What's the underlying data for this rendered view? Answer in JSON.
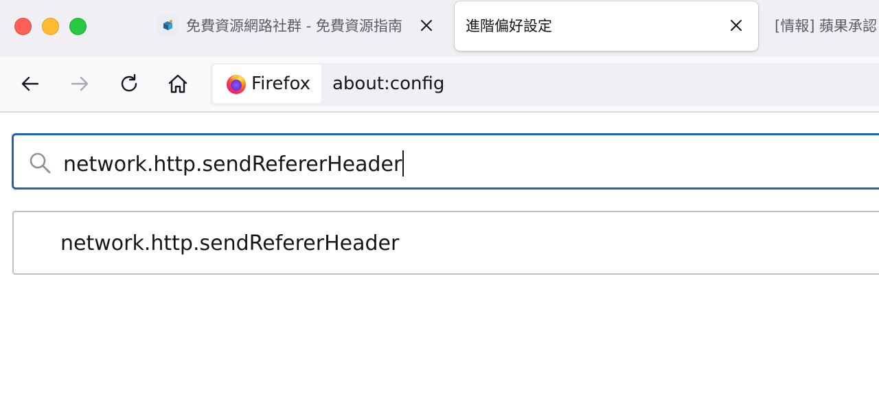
{
  "window": {
    "controls": [
      "close",
      "minimize",
      "maximize"
    ]
  },
  "tabs": [
    {
      "title": "免費資源網路社群 - 免費資源指南",
      "favicon": "site-logo-icon",
      "active": false,
      "has_close": true
    },
    {
      "title": "進階偏好設定",
      "favicon": null,
      "active": true,
      "has_close": true
    },
    {
      "title": "[情報] 蘋果承認",
      "favicon": null,
      "active": false,
      "has_close": false
    }
  ],
  "toolbar": {
    "buttons": [
      "back-icon",
      "forward-icon",
      "reload-icon",
      "home-icon"
    ],
    "forward_enabled": false
  },
  "urlbar": {
    "identity_label": "Firefox",
    "identity_icon": "firefox-logo-icon",
    "url": "about:config"
  },
  "config": {
    "search": {
      "value": "network.http.sendRefererHeader",
      "icon": "search-icon"
    },
    "results": [
      {
        "name": "network.http.sendRefererHeader"
      }
    ]
  },
  "colors": {
    "accent": "#1d63b8",
    "tabstrip_bg": "#f0f0f4",
    "traffic_close": "#ff5f57",
    "traffic_minimize": "#febc2e",
    "traffic_maximize": "#28c840"
  }
}
